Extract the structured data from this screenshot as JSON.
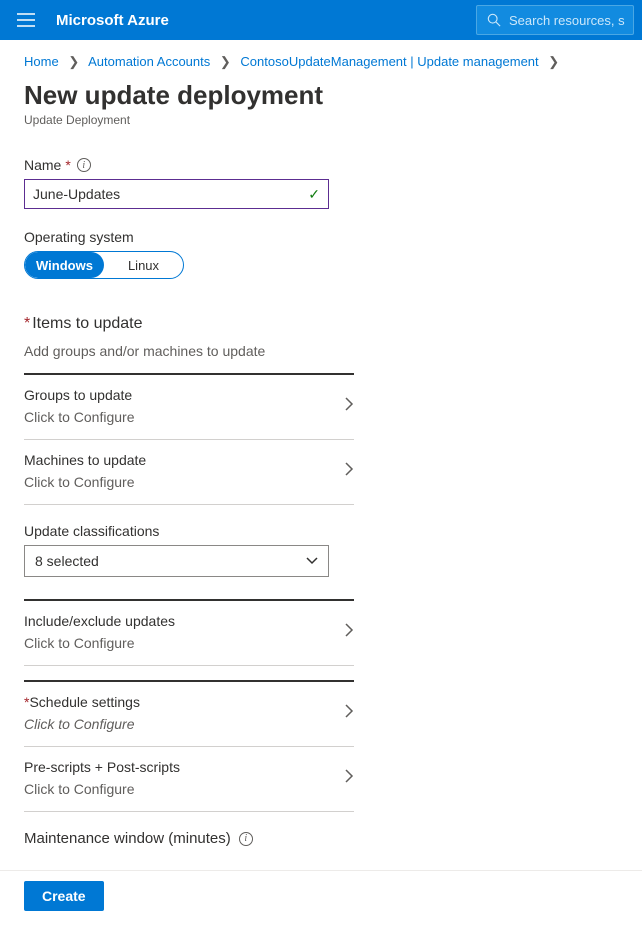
{
  "topbar": {
    "product": "Microsoft Azure",
    "search_placeholder": "Search resources, s"
  },
  "breadcrumbs": {
    "items": [
      "Home",
      "Automation Accounts",
      "ContosoUpdateManagement | Update management"
    ]
  },
  "page": {
    "title": "New update deployment",
    "subtitle": "Update Deployment"
  },
  "form": {
    "name_label": "Name",
    "name_value": "June-Updates",
    "os_label": "Operating system",
    "os_windows": "Windows",
    "os_linux": "Linux",
    "items_title": "Items to update",
    "items_sub": "Add groups and/or machines to update",
    "groups": {
      "label": "Groups to update",
      "sub": "Click to Configure"
    },
    "machines": {
      "label": "Machines to update",
      "sub": "Click to Configure"
    },
    "class_label": "Update classifications",
    "class_value": "8 selected",
    "include": {
      "label": "Include/exclude updates",
      "sub": "Click to Configure"
    },
    "schedule": {
      "label": "Schedule settings",
      "sub": "Click to Configure"
    },
    "scripts": {
      "label": "Pre-scripts + Post-scripts",
      "sub": "Click to Configure"
    },
    "maintenance_label": "Maintenance window (minutes)"
  },
  "footer": {
    "create": "Create"
  }
}
